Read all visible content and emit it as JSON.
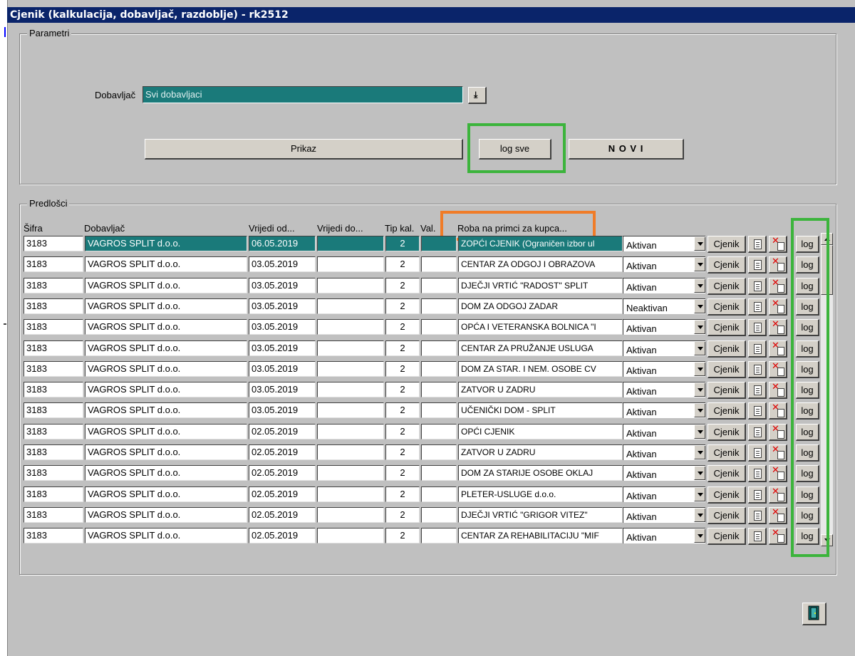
{
  "window": {
    "title": "Cjenik (kalkulacija, dobavljač, razdoblje) - rk2512"
  },
  "parametri": {
    "legend": "Parametri",
    "dobavljac_label": "Dobavljač",
    "dobavljac_value": "Svi dobavljaci",
    "prikaz_label": "Prikaz",
    "log_sve_label": "log sve",
    "novi_label": "N O V I"
  },
  "predlosci": {
    "legend": "Predlošci",
    "columns": {
      "sifra": "Šifra",
      "dobavljac": "Dobavljač",
      "vrijedi_od": "Vrijedi od...",
      "vrijedi_do": "Vrijedi do...",
      "tip_kal": "Tip kal.",
      "val": "Val.",
      "roba": "Roba na primci za kupca..."
    },
    "cjenik_label": "Cjenik",
    "log_label": "log",
    "rows": [
      {
        "sifra": "3183",
        "dobavljac": "VAGROS SPLIT d.o.o.",
        "od": "06.05.2019",
        "do": "",
        "tip": "2",
        "val": "",
        "naziv": "ZOPĆI CJENIK (Ograničen izbor ul",
        "status": "Aktivan"
      },
      {
        "sifra": "3183",
        "dobavljac": "VAGROS SPLIT d.o.o.",
        "od": "03.05.2019",
        "do": "",
        "tip": "2",
        "val": "",
        "naziv": "CENTAR ZA ODGOJ I OBRAZOVA",
        "status": "Aktivan"
      },
      {
        "sifra": "3183",
        "dobavljac": "VAGROS SPLIT d.o.o.",
        "od": "03.05.2019",
        "do": "",
        "tip": "2",
        "val": "",
        "naziv": "DJEČJI VRTIĆ \"RADOST\" SPLIT",
        "status": "Aktivan"
      },
      {
        "sifra": "3183",
        "dobavljac": "VAGROS SPLIT d.o.o.",
        "od": "03.05.2019",
        "do": "",
        "tip": "2",
        "val": "",
        "naziv": "DOM ZA ODGOJ ZADAR",
        "status": "Neaktivan"
      },
      {
        "sifra": "3183",
        "dobavljac": "VAGROS SPLIT d.o.o.",
        "od": "03.05.2019",
        "do": "",
        "tip": "2",
        "val": "",
        "naziv": "OPĆA I VETERANSKA BOLNICA \"I",
        "status": "Aktivan"
      },
      {
        "sifra": "3183",
        "dobavljac": "VAGROS SPLIT d.o.o.",
        "od": "03.05.2019",
        "do": "",
        "tip": "2",
        "val": "",
        "naziv": "CENTAR ZA PRUŽANJE USLUGA",
        "status": "Aktivan"
      },
      {
        "sifra": "3183",
        "dobavljac": "VAGROS SPLIT d.o.o.",
        "od": "03.05.2019",
        "do": "",
        "tip": "2",
        "val": "",
        "naziv": "DOM ZA STAR. I NEM. OSOBE CV",
        "status": "Aktivan"
      },
      {
        "sifra": "3183",
        "dobavljac": "VAGROS SPLIT d.o.o.",
        "od": "03.05.2019",
        "do": "",
        "tip": "2",
        "val": "",
        "naziv": "ZATVOR U ZADRU",
        "status": "Aktivan"
      },
      {
        "sifra": "3183",
        "dobavljac": "VAGROS SPLIT d.o.o.",
        "od": "03.05.2019",
        "do": "",
        "tip": "2",
        "val": "",
        "naziv": "UČENIČKI DOM - SPLIT",
        "status": "Aktivan"
      },
      {
        "sifra": "3183",
        "dobavljac": "VAGROS SPLIT d.o.o.",
        "od": "02.05.2019",
        "do": "",
        "tip": "2",
        "val": "",
        "naziv": "OPĆI CJENIK",
        "status": "Aktivan"
      },
      {
        "sifra": "3183",
        "dobavljac": "VAGROS SPLIT d.o.o.",
        "od": "02.05.2019",
        "do": "",
        "tip": "2",
        "val": "",
        "naziv": "ZATVOR U ZADRU",
        "status": "Aktivan"
      },
      {
        "sifra": "3183",
        "dobavljac": "VAGROS SPLIT d.o.o.",
        "od": "02.05.2019",
        "do": "",
        "tip": "2",
        "val": "",
        "naziv": "DOM ZA STARIJE OSOBE OKLAJ",
        "status": "Aktivan"
      },
      {
        "sifra": "3183",
        "dobavljac": "VAGROS SPLIT d.o.o.",
        "od": "02.05.2019",
        "do": "",
        "tip": "2",
        "val": "",
        "naziv": "PLETER-USLUGE d.o.o.",
        "status": "Aktivan"
      },
      {
        "sifra": "3183",
        "dobavljac": "VAGROS SPLIT d.o.o.",
        "od": "02.05.2019",
        "do": "",
        "tip": "2",
        "val": "",
        "naziv": "DJEČJI VRTIĆ \"GRIGOR VITEZ\"",
        "status": "Aktivan"
      },
      {
        "sifra": "3183",
        "dobavljac": "VAGROS SPLIT d.o.o.",
        "od": "02.05.2019",
        "do": "",
        "tip": "2",
        "val": "",
        "naziv": "CENTAR ZA REHABILITACIJU \"MIF",
        "status": "Aktivan"
      }
    ]
  },
  "colors": {
    "title_bar": "#0a246a",
    "selection": "#1a7a7a",
    "highlight_green": "#3cb43c",
    "highlight_orange": "#f07c28"
  },
  "icons": [
    "dropdown-arrow-icon",
    "document-icon",
    "delete-icon",
    "exit-door-icon"
  ]
}
